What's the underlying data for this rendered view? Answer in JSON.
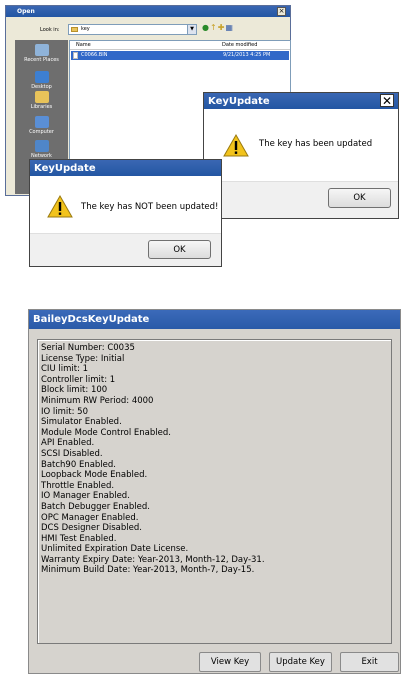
{
  "open_dialog": {
    "title": "Open",
    "close_label": "×",
    "look_in_label": "Look in:",
    "look_in_value": "key",
    "places": [
      "Recent Places",
      "Desktop",
      "Libraries",
      "Computer",
      "Network"
    ],
    "columns": [
      "Name",
      "Date modified"
    ],
    "files": [
      {
        "name": "C0066.BIN",
        "date": "9/21/2013 4:25 PM"
      }
    ]
  },
  "keyupdate_success": {
    "title": "KeyUpdate",
    "close_label": "✕",
    "message": "The key has been updated",
    "ok_label": "OK"
  },
  "keyupdate_fail": {
    "title": "KeyUpdate",
    "message": "The key has NOT been updated!",
    "ok_label": "OK"
  },
  "bailey": {
    "title": "BaileyDcsKeyUpdate",
    "info_lines": [
      "Serial Number: C0035",
      "License Type: Initial",
      "CIU limit: 1",
      "Controller limit: 1",
      "Block limit: 100",
      "Minimum RW Period: 4000",
      "IO limit: 50",
      "Simulator Enabled.",
      "Module Mode Control Enabled.",
      "API Enabled.",
      "SCSI Disabled.",
      "Batch90 Enabled.",
      "Loopback Mode Enabled.",
      "Throttle Enabled.",
      "IO Manager Enabled.",
      "Batch Debugger Enabled.",
      "OPC Manager Enabled.",
      "DCS Designer Disabled.",
      "HMI Test Enabled.",
      "Unlimited Expiration Date License.",
      "Warranty Expiry Date: Year-2013, Month-12, Day-31.",
      "Minimum Build Date: Year-2013, Month-7, Day-15."
    ],
    "buttons": {
      "view_key": "View Key",
      "update_key": "Update Key",
      "exit": "Exit"
    }
  }
}
